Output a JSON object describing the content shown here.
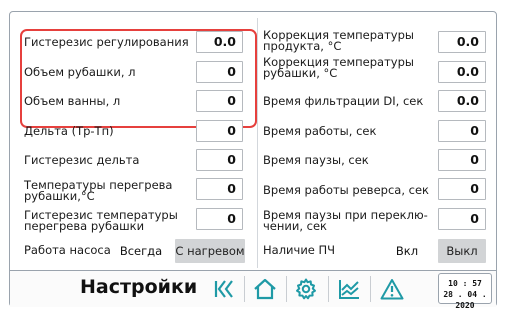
{
  "left": {
    "hysteresis_reg": {
      "label": "Гистерезис регулирования",
      "value": "0.0"
    },
    "jacket_volume": {
      "label": "Объем рубашки, л",
      "value": "0"
    },
    "bath_volume": {
      "label": "Объем ванны, л",
      "value": "0"
    },
    "delta": {
      "label": "Дельта (Tр-Tп)",
      "value": "0"
    },
    "delta_hysteresis": {
      "label": "Гистерезис дельта",
      "value": "0"
    },
    "overheat_temp": {
      "label": "Температуры перегрева\nрубашки,°С",
      "value": "0"
    },
    "overheat_hysteresis": {
      "label": "Гистерезис температуры\nперегрева рубашки",
      "value": "0"
    },
    "pump": {
      "label": "Работа насоса",
      "opt1": "Всегда",
      "opt2": "С нагревом"
    }
  },
  "right": {
    "product_temp_corr": {
      "label": "Коррекция температуры\nпродукта, °С",
      "value": "0.0"
    },
    "jacket_temp_corr": {
      "label": "Коррекция температуры\nрубашки, °С",
      "value": "0.0"
    },
    "di_filter": {
      "label": "Время фильтрации DI, сек",
      "value": "0.0"
    },
    "work_time": {
      "label": "Время работы, сек",
      "value": "0"
    },
    "pause_time": {
      "label": "Время паузы, сек",
      "value": "0"
    },
    "reverse_time": {
      "label": "Время работы реверса, сек",
      "value": "0"
    },
    "switch_pause": {
      "label": "Время паузы при переклю-\nчении, сек",
      "value": "0"
    },
    "vfd": {
      "label": "Наличие ПЧ",
      "opt1": "Вкл",
      "opt2": "Выкл"
    }
  },
  "footer": {
    "title": "Настройки",
    "time": "10 : 57",
    "date": "28 . 04 . 2020"
  },
  "icons": [
    "back-to-start-icon",
    "home-icon",
    "gear-icon",
    "trend-chart-icon",
    "warning-icon"
  ],
  "colors": {
    "highlight": "#e6403d",
    "icon_teal": "#1f9aa6",
    "selected_toggle": "#d2d4d6"
  }
}
